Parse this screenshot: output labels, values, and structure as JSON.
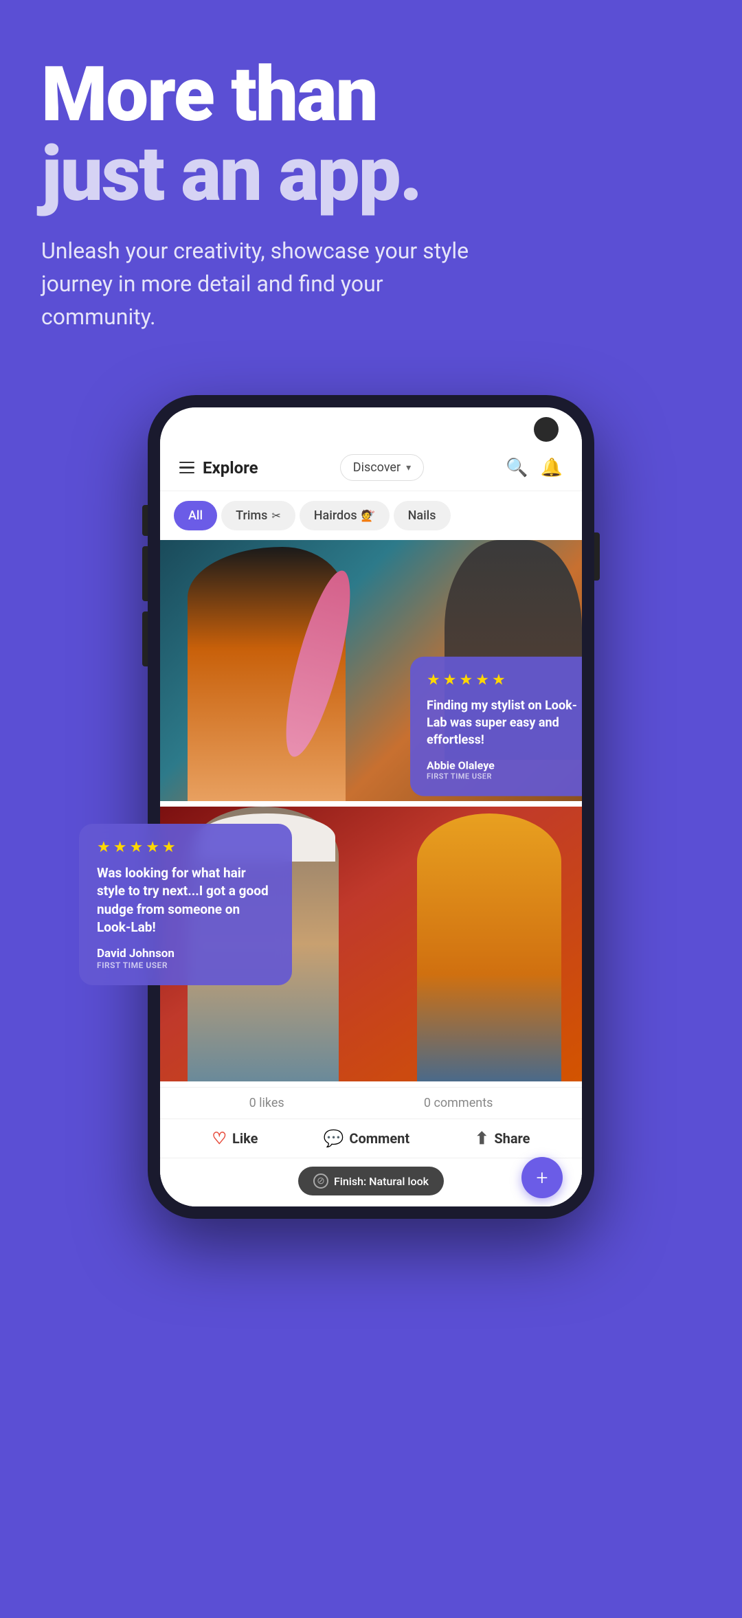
{
  "hero": {
    "title_line1": "More than",
    "title_line2": "just an app.",
    "subtitle": "Unleash your creativity, showcase your style journey in more detail and find your community."
  },
  "app": {
    "header": {
      "explore_label": "Explore",
      "discover_label": "Discover",
      "discover_chevron": "▾"
    },
    "filters": [
      {
        "label": "All",
        "active": true,
        "icon": ""
      },
      {
        "label": "Trims",
        "active": false,
        "icon": "✂"
      },
      {
        "label": "Hairdos",
        "active": false,
        "icon": "💇"
      },
      {
        "label": "Nails",
        "active": false,
        "icon": ""
      }
    ],
    "review_1": {
      "stars": "★★★★★",
      "text": "Finding my stylist on Look-Lab was super easy and effortless!",
      "name": "Abbie Olaleye",
      "badge": "FIRST TIME USER"
    },
    "review_2": {
      "stars": "★★★★★",
      "text": "Was looking for what hair style to try next...I got a good nudge from someone on Look-Lab!",
      "name": "David Johnson",
      "badge": "FIRST TIME USER"
    },
    "post_stats": {
      "likes": "0 likes",
      "comments": "0 comments"
    },
    "actions": {
      "like": "Like",
      "comment": "Comment",
      "share": "Share"
    },
    "finish_tag": "Finish: Natural look",
    "fab_label": "+"
  }
}
